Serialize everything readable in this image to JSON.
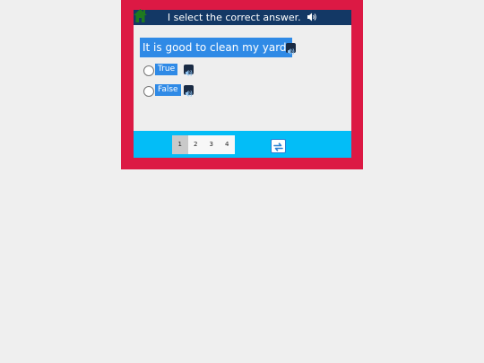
{
  "header": {
    "title": "I select the correct answer.",
    "home_icon": "home-icon",
    "speaker_icon": "speaker-icon"
  },
  "question": {
    "text": "It is good to clean my yard.",
    "audio_icon": "audio-icon"
  },
  "options": [
    {
      "label": "True",
      "selected": false
    },
    {
      "label": "False",
      "selected": false
    }
  ],
  "pagination": {
    "pages": [
      "1",
      "2",
      "3",
      "4"
    ],
    "current": "1"
  },
  "colors": {
    "frame": "#dc1944",
    "header": "#133865",
    "accent": "#2f8ae6",
    "footer": "#03bdf7"
  },
  "refresh_icon": "refresh-icon"
}
